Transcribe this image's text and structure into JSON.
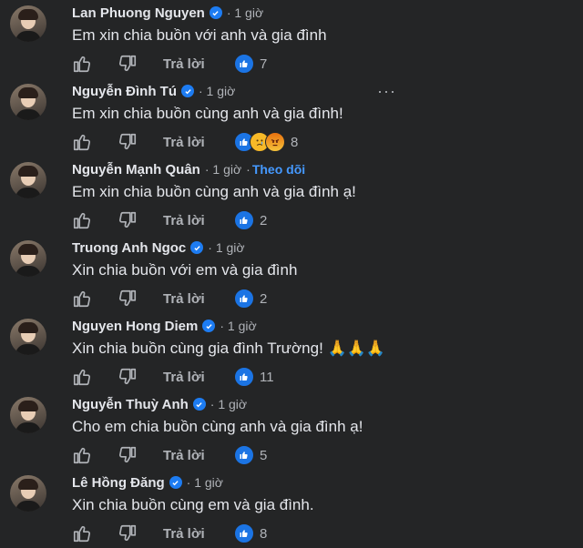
{
  "comments": [
    {
      "name": "Lan Phuong Nguyen",
      "verified": true,
      "time": "1 giờ",
      "follow": "",
      "text": "Em xin chia buồn với anh và gia đình",
      "reply": "Trả lời",
      "reactions": [
        "like"
      ],
      "count": "7",
      "more": false
    },
    {
      "name": "Nguyễn Đình Tú",
      "verified": true,
      "time": "1 giờ",
      "follow": "",
      "text": "Em xin chia buồn cùng anh và gia đình!",
      "reply": "Trả lời",
      "reactions": [
        "like",
        "sad",
        "angry"
      ],
      "count": "8",
      "more": true
    },
    {
      "name": "Nguyễn Mạnh Quân",
      "verified": false,
      "time": "1 giờ",
      "follow": "Theo dõi",
      "text": "Em xin chia buồn cùng anh và gia đình ạ!",
      "reply": "Trả lời",
      "reactions": [
        "like"
      ],
      "count": "2",
      "more": false
    },
    {
      "name": "Truong Anh Ngoc",
      "verified": true,
      "time": "1 giờ",
      "follow": "",
      "text": "Xin chia buồn với em và gia đình",
      "reply": "Trả lời",
      "reactions": [
        "like"
      ],
      "count": "2",
      "more": false
    },
    {
      "name": "Nguyen Hong Diem",
      "verified": true,
      "time": "1 giờ",
      "follow": "",
      "text": "Xin chia buồn cùng gia đình Trường! 🙏🙏🙏",
      "reply": "Trả lời",
      "reactions": [
        "like"
      ],
      "count": "11",
      "more": false
    },
    {
      "name": "Nguyễn Thuỳ Anh",
      "verified": true,
      "time": "1 giờ",
      "follow": "",
      "text": "Cho em chia buồn cùng anh và gia đình ạ!",
      "reply": "Trả lời",
      "reactions": [
        "like"
      ],
      "count": "5",
      "more": false
    },
    {
      "name": "Lê Hồng Đăng",
      "verified": true,
      "time": "1 giờ",
      "follow": "",
      "text": "Xin chia buồn cùng em và gia đình.",
      "reply": "Trả lời",
      "reactions": [
        "like"
      ],
      "count": "8",
      "more": false
    }
  ],
  "ui": {
    "dot": "·",
    "more_label": "···"
  },
  "colors": {
    "background": "#242526",
    "text": "#e4e6eb",
    "secondary": "#b0b3b8",
    "link": "#4599ff",
    "like": "#1b74e4",
    "verified": "#1d7cf2"
  },
  "icons": {
    "like_button": "thumbs-up-outline-icon",
    "dislike_button": "thumbs-down-outline-icon",
    "verified": "verified-badge-icon",
    "like_reaction": "like-reaction-icon",
    "sad_reaction": "sad-reaction-icon",
    "angry_reaction": "angry-reaction-icon"
  }
}
